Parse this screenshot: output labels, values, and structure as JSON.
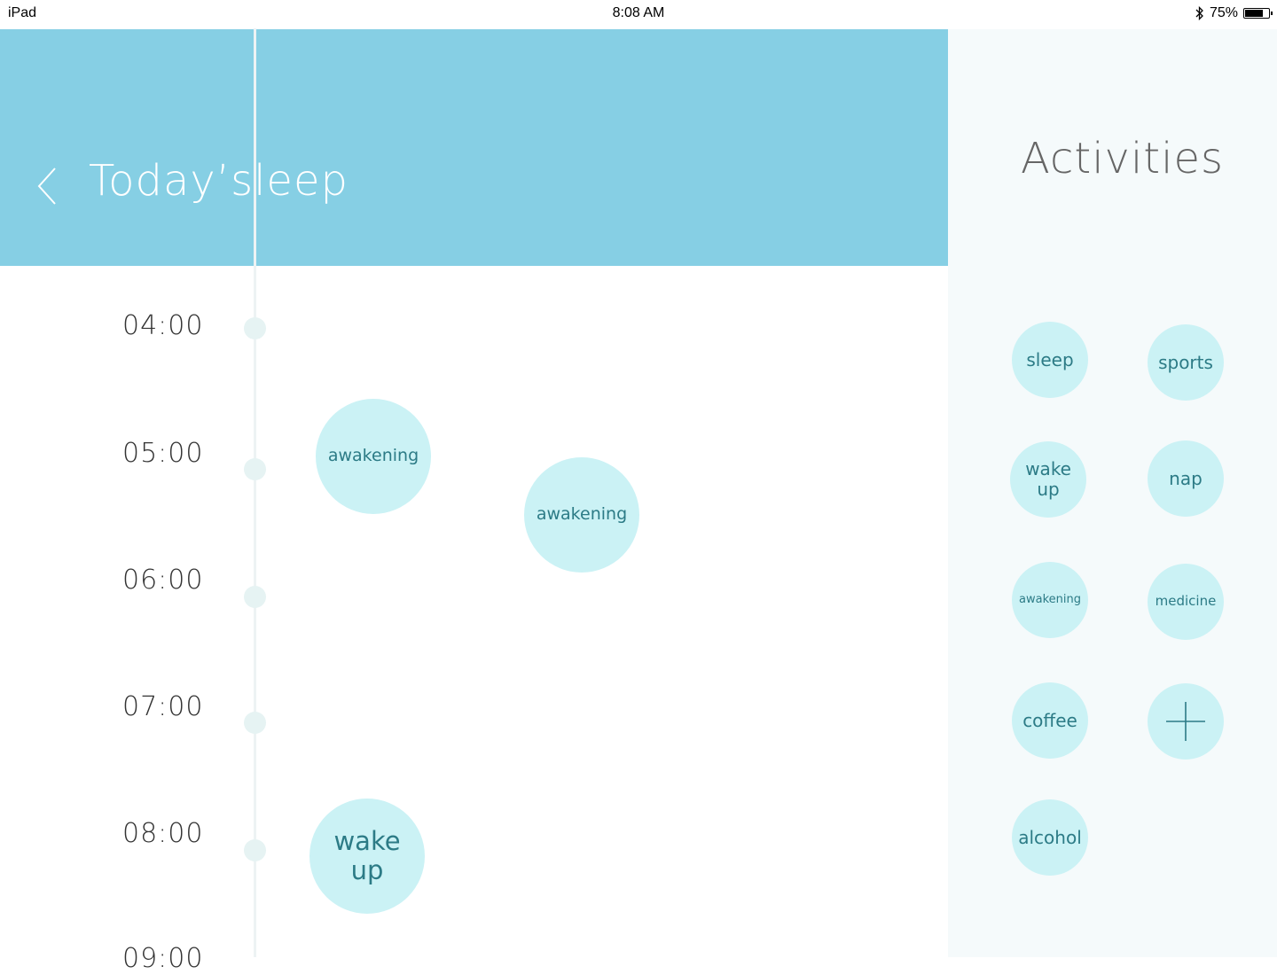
{
  "status_bar": {
    "device": "iPad",
    "time": "8:08 AM",
    "bluetooth_icon": "bluetooth-icon",
    "battery_percent": "75%",
    "battery_level": 0.75
  },
  "header": {
    "title": "Today’sleep",
    "back_icon": "chevron-left-icon"
  },
  "timeline": {
    "times": [
      "04:00",
      "05:00",
      "06:00",
      "07:00",
      "08:00",
      "09:00"
    ],
    "events": [
      {
        "label": "awakening"
      },
      {
        "label": "awakening"
      },
      {
        "label": "wake up"
      }
    ]
  },
  "activities": {
    "title": "Activities",
    "items": [
      {
        "label": "sleep"
      },
      {
        "label": "sports"
      },
      {
        "label": "wake up"
      },
      {
        "label": "nap"
      },
      {
        "label": "awakening"
      },
      {
        "label": "medicine"
      },
      {
        "label": "coffee"
      },
      {
        "label": "add"
      },
      {
        "label": "alcohol"
      }
    ],
    "add_icon": "plus-icon"
  },
  "colors": {
    "header": "#86cfe4",
    "bubble": "#cbf2f5",
    "bubble_text": "#2c7b86",
    "panel": "#f5fafb"
  }
}
